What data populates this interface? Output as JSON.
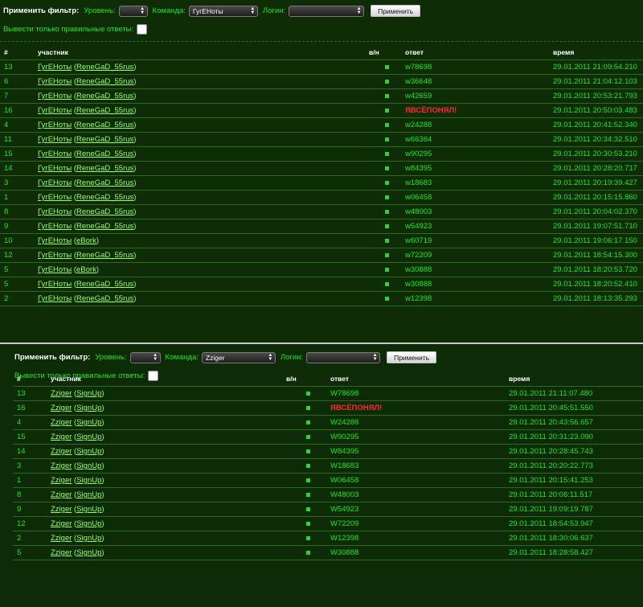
{
  "panel1": {
    "filter": {
      "title": "Применить фильтр:",
      "level_label": "Уровень:",
      "level_value": "",
      "team_label": "Команда:",
      "team_value": "ГугЕНоты",
      "login_label": "Логин:",
      "login_value": "",
      "apply_label": "Применить",
      "only_correct_label": "Вывести только правильные ответы:"
    },
    "columns": [
      "#",
      "участник",
      "в/н",
      "ответ",
      "время"
    ],
    "rows": [
      {
        "num": "13",
        "team": "ГугЕНоты",
        "login": "ReneGaD_55rus",
        "answer": "w78698",
        "bad": false,
        "time": "29.01.2011 21:09:54.210"
      },
      {
        "num": "6",
        "team": "ГугЕНоты",
        "login": "ReneGaD_55rus",
        "answer": "w36648",
        "bad": false,
        "time": "29.01.2011 21:04:12.103"
      },
      {
        "num": "7",
        "team": "ГугЕНоты",
        "login": "ReneGaD_55rus",
        "answer": "w42659",
        "bad": false,
        "time": "29.01.2011 20:53:21.793"
      },
      {
        "num": "16",
        "team": "ГугЕНоты",
        "login": "ReneGaD_55rus",
        "answer": "ЯВСЁПОНЯЛ!",
        "bad": true,
        "time": "29.01.2011 20:50:03.483"
      },
      {
        "num": "4",
        "team": "ГугЕНоты",
        "login": "ReneGaD_55rus",
        "answer": "w24288",
        "bad": false,
        "time": "29.01.2011 20:41:52.340"
      },
      {
        "num": "11",
        "team": "ГугЕНоты",
        "login": "ReneGaD_55rus",
        "answer": "w66364",
        "bad": false,
        "time": "29.01.2011 20:34:32.510"
      },
      {
        "num": "15",
        "team": "ГугЕНоты",
        "login": "ReneGaD_55rus",
        "answer": "w90295",
        "bad": false,
        "time": "29.01.2011 20:30:53.210"
      },
      {
        "num": "14",
        "team": "ГугЕНоты",
        "login": "ReneGaD_55rus",
        "answer": "w84395",
        "bad": false,
        "time": "29.01.2011 20:28:20.717"
      },
      {
        "num": "3",
        "team": "ГугЕНоты",
        "login": "ReneGaD_55rus",
        "answer": "w18683",
        "bad": false,
        "time": "29.01.2011 20:19:39.427"
      },
      {
        "num": "1",
        "team": "ГугЕНоты",
        "login": "ReneGaD_55rus",
        "answer": "w06458",
        "bad": false,
        "time": "29.01.2011 20:15:15.860"
      },
      {
        "num": "8",
        "team": "ГугЕНоты",
        "login": "ReneGaD_55rus",
        "answer": "w48003",
        "bad": false,
        "time": "29.01.2011 20:04:02.370"
      },
      {
        "num": "9",
        "team": "ГугЕНоты",
        "login": "ReneGaD_55rus",
        "answer": "w54923",
        "bad": false,
        "time": "29.01.2011 19:07:51.710"
      },
      {
        "num": "10",
        "team": "ГугЕНоты",
        "login": "eBork",
        "answer": "w60719",
        "bad": false,
        "time": "29.01.2011 19:06:17.150"
      },
      {
        "num": "12",
        "team": "ГугЕНоты",
        "login": "ReneGaD_55rus",
        "answer": "w72209",
        "bad": false,
        "time": "29.01.2011 18:54:15.300"
      },
      {
        "num": "5",
        "team": "ГугЕНоты",
        "login": "eBork",
        "answer": "w30888",
        "bad": false,
        "time": "29.01.2011 18:20:53.720"
      },
      {
        "num": "5",
        "team": "ГугЕНоты",
        "login": "ReneGaD_55rus",
        "answer": "w30888",
        "bad": false,
        "time": "29.01.2011 18:20:52.410"
      },
      {
        "num": "2",
        "team": "ГугЕНоты",
        "login": "ReneGaD_55rus",
        "answer": "w12398",
        "bad": false,
        "time": "29.01.2011 18:13:35.293"
      }
    ]
  },
  "panel2": {
    "filter": {
      "title": "Применить фильтр:",
      "level_label": "Уровень:",
      "level_value": "",
      "team_label": "Команда:",
      "team_value": "Zziger",
      "login_label": "Логин:",
      "login_value": "",
      "apply_label": "Применить",
      "only_correct_label": "Вывести только правильные ответы:"
    },
    "columns": [
      "#",
      "участник",
      "в/н",
      "ответ",
      "время"
    ],
    "rows": [
      {
        "num": "13",
        "team": "Zziger",
        "login": "SignUp",
        "answer": "W78698",
        "bad": false,
        "time": "29.01.2011 21:11:07.480"
      },
      {
        "num": "16",
        "team": "Zziger",
        "login": "SignUp",
        "answer": "ЯВСЁПОНЯЛ!",
        "bad": true,
        "time": "29.01.2011 20:45:51.550"
      },
      {
        "num": "4",
        "team": "Zziger",
        "login": "SignUp",
        "answer": "W24288",
        "bad": false,
        "time": "29.01.2011 20:43:56.657"
      },
      {
        "num": "15",
        "team": "Zziger",
        "login": "SignUp",
        "answer": "W90295",
        "bad": false,
        "time": "29.01.2011 20:31:23.090"
      },
      {
        "num": "14",
        "team": "Zziger",
        "login": "SignUp",
        "answer": "W84395",
        "bad": false,
        "time": "29.01.2011 20:28:45.743"
      },
      {
        "num": "3",
        "team": "Zziger",
        "login": "SignUp",
        "answer": "W18683",
        "bad": false,
        "time": "29.01.2011 20:20:22.773"
      },
      {
        "num": "1",
        "team": "Zziger",
        "login": "SignUp",
        "answer": "W06458",
        "bad": false,
        "time": "29.01.2011 20:15:41.253"
      },
      {
        "num": "8",
        "team": "Zziger",
        "login": "SignUp",
        "answer": "W48003",
        "bad": false,
        "time": "29.01.2011 20:06:11.517"
      },
      {
        "num": "9",
        "team": "Zziger",
        "login": "SignUp",
        "answer": "W54923",
        "bad": false,
        "time": "29.01.2011 19:09:19.787"
      },
      {
        "num": "12",
        "team": "Zziger",
        "login": "SignUp",
        "answer": "W72209",
        "bad": false,
        "time": "29.01.2011 18:54:53.947"
      },
      {
        "num": "2",
        "team": "Zziger",
        "login": "SignUp",
        "answer": "W12398",
        "bad": false,
        "time": "29.01.2011 18:30:06.637"
      },
      {
        "num": "5",
        "team": "Zziger",
        "login": "SignUp",
        "answer": "W30888",
        "bad": false,
        "time": "29.01.2011 18:28:58.427"
      }
    ]
  },
  "colors": {
    "text_green": "#1ee61e",
    "link_green": "#9aff6a",
    "wrong_red": "#ff2a2a",
    "background": "#0e2d07",
    "row_border": "#2b6a1f"
  },
  "icons": {
    "correct_marker": "green-square-icon",
    "select_arrows": "updown-arrows-icon"
  }
}
